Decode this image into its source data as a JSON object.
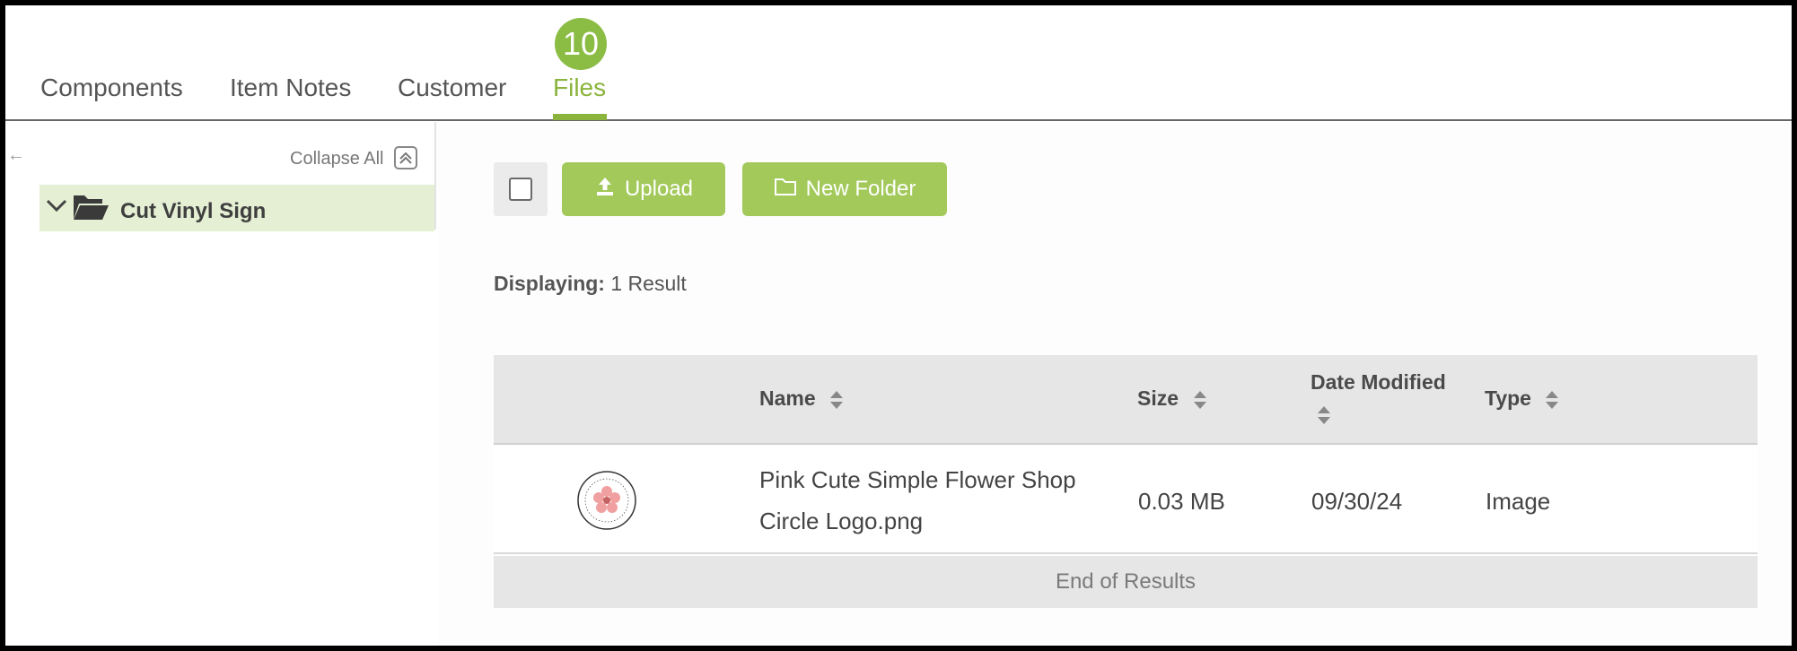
{
  "tabs": [
    {
      "label": "Components"
    },
    {
      "label": "Item Notes"
    },
    {
      "label": "Customer"
    },
    {
      "label": "Files",
      "badge": "10",
      "active": true
    }
  ],
  "tree": {
    "collapse_label": "Collapse All",
    "items": [
      {
        "label": "Cut Vinyl Sign",
        "expanded": true
      }
    ]
  },
  "toolbar": {
    "upload_label": "Upload",
    "new_folder_label": "New Folder"
  },
  "results": {
    "prefix": "Displaying:",
    "value": "1 Result"
  },
  "table": {
    "columns": [
      "Name",
      "Size",
      "Date Modified",
      "Type"
    ],
    "rows": [
      {
        "name_line1": "Pink Cute Simple Flower Shop",
        "name_line2": "Circle Logo.png",
        "size": "0.03 MB",
        "date": "09/30/24",
        "type": "Image"
      }
    ],
    "end_label": "End of Results"
  },
  "colors": {
    "accent": "#8ab43c",
    "button": "#a2c95a",
    "tree_selected": "#e4efd3"
  },
  "icons": [
    "back-arrow-icon",
    "collapse-all-icon",
    "chevron-down-icon",
    "folder-open-icon",
    "upload-icon",
    "folder-icon",
    "sort-icon"
  ]
}
